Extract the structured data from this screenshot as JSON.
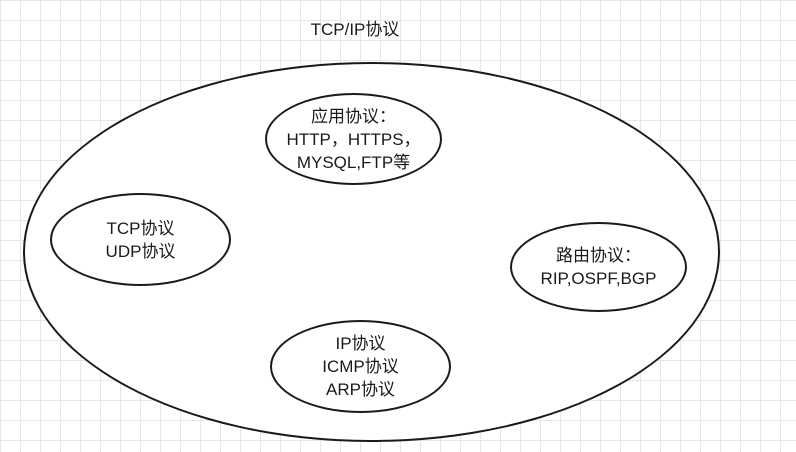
{
  "title": "TCP/IP协议",
  "outer_ellipse": {
    "nodes": [
      {
        "id": "application",
        "lines": [
          "应用协议：",
          "HTTP，HTTPS，",
          "MYSQL,FTP等"
        ]
      },
      {
        "id": "transport",
        "lines": [
          "TCP协议",
          "UDP协议"
        ]
      },
      {
        "id": "routing",
        "lines": [
          "路由协议：",
          "RIP,OSPF,BGP"
        ]
      },
      {
        "id": "network",
        "lines": [
          "IP协议",
          "ICMP协议",
          "ARP协议"
        ]
      }
    ]
  },
  "colors": {
    "stroke": "#1a1a1a",
    "grid": "#e6e6e6",
    "background": "#ffffff"
  }
}
